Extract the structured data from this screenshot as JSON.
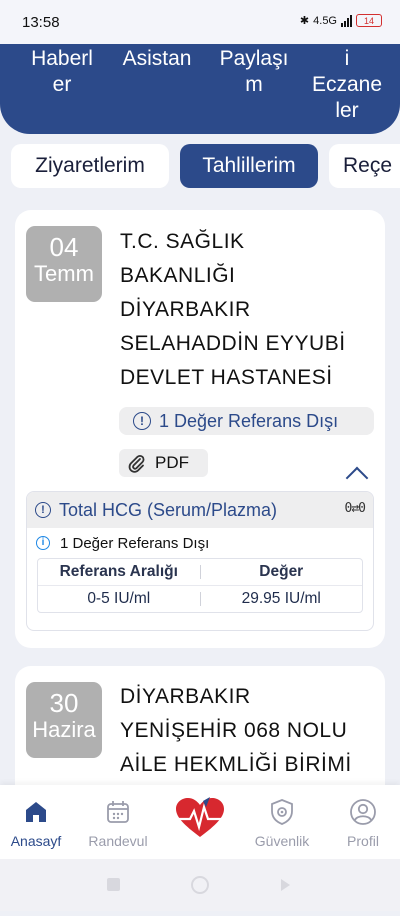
{
  "status": {
    "time": "13:58",
    "network": "4.5G",
    "battery": "14"
  },
  "banner": {
    "items": [
      {
        "label": "Haberl\ner"
      },
      {
        "label": "Asistan"
      },
      {
        "label": "Paylaşı\nm"
      },
      {
        "label": "i\nEczane\nler"
      }
    ]
  },
  "tabs": [
    {
      "label": "Ziyaretlerim"
    },
    {
      "label": "Tahlillerim"
    },
    {
      "label": "Reçe"
    }
  ],
  "card1": {
    "day": "04",
    "month": "Temm",
    "hospital": "T.C. SAĞLIK\nBAKANLIĞI\nDİYARBAKIR\nSELAHADDİN EYYUBİ\nDEVLET HASTANESİ",
    "ref_notice": "1 Değer Referans Dışı",
    "pdf_label": "PDF",
    "test": {
      "name": "Total HCG (Serum/Plazma)",
      "notice": "1 Değer Referans Dışı",
      "col_range": "Referans Aralığı",
      "col_value": "Değer",
      "range": "0-5 IU/ml",
      "value": "29.95 IU/ml"
    }
  },
  "card2": {
    "day": "30",
    "month": "Hazira",
    "hospital": "DİYARBAKIR\nYENİŞEHİR 068 NOLU\nAİLE HEKMLİĞİ BİRİMİ"
  },
  "nav": {
    "items": [
      {
        "label": "Anasayf",
        "icon": "home-icon"
      },
      {
        "label": "Randevul",
        "icon": "calendar-icon"
      },
      {
        "label": "",
        "icon": "heart-logo-icon"
      },
      {
        "label": "Güvenlik",
        "icon": "shield-gear-icon"
      },
      {
        "label": "Profil",
        "icon": "profile-icon"
      }
    ]
  },
  "colors": {
    "primary": "#2c4a8a",
    "badge_gray": "#b0b0b0",
    "info_blue": "#1e88e5"
  }
}
